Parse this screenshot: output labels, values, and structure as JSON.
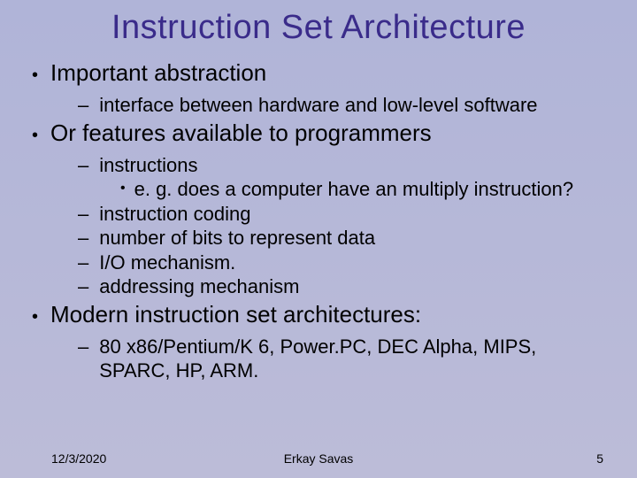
{
  "title": "Instruction Set Architecture",
  "b1": "Important abstraction",
  "b1s1": "interface between hardware and low-level software",
  "b2": "Or features available to programmers",
  "b2s1": "instructions",
  "b2s1a": "e. g. does a computer have an multiply instruction?",
  "b2s2": "instruction coding",
  "b2s3": "number of bits to represent data",
  "b2s4": "I/O mechanism.",
  "b2s5": "addressing mechanism",
  "b3": "Modern instruction set architectures:",
  "b3s1": "80 x86/Pentium/K 6,  Power.PC,  DEC Alpha,  MIPS, SPARC, HP, ARM.",
  "footer": {
    "date": "12/3/2020",
    "author": "Erkay Savas",
    "page": "5"
  }
}
